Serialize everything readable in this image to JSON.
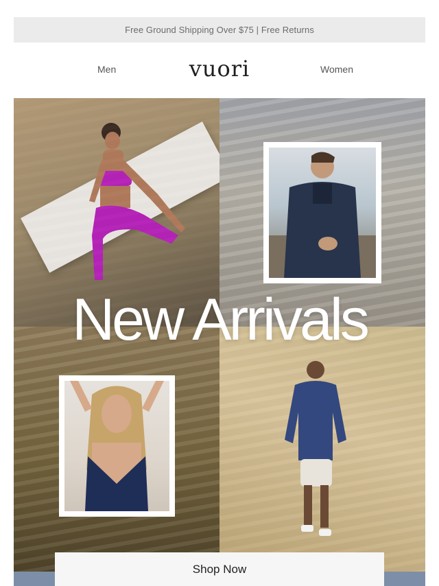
{
  "promo_bar": {
    "text": "Free Ground Shipping Over $75 | Free Returns"
  },
  "nav": {
    "left_link": "Men",
    "logo": "vuori",
    "right_link": "Women"
  },
  "hero": {
    "headline": "New Arrivals",
    "cta_label": "Shop Now",
    "images": [
      "woman-yoga-pink-outfit",
      "man-navy-jacket-beach",
      "woman-navy-sports-bra",
      "man-blue-hoodie-dunes"
    ]
  },
  "colors": {
    "promo_bg": "#ebebeb",
    "cta_bg": "#f6f6f6",
    "headline": "#ffffff",
    "band": "#7d8fa8"
  }
}
